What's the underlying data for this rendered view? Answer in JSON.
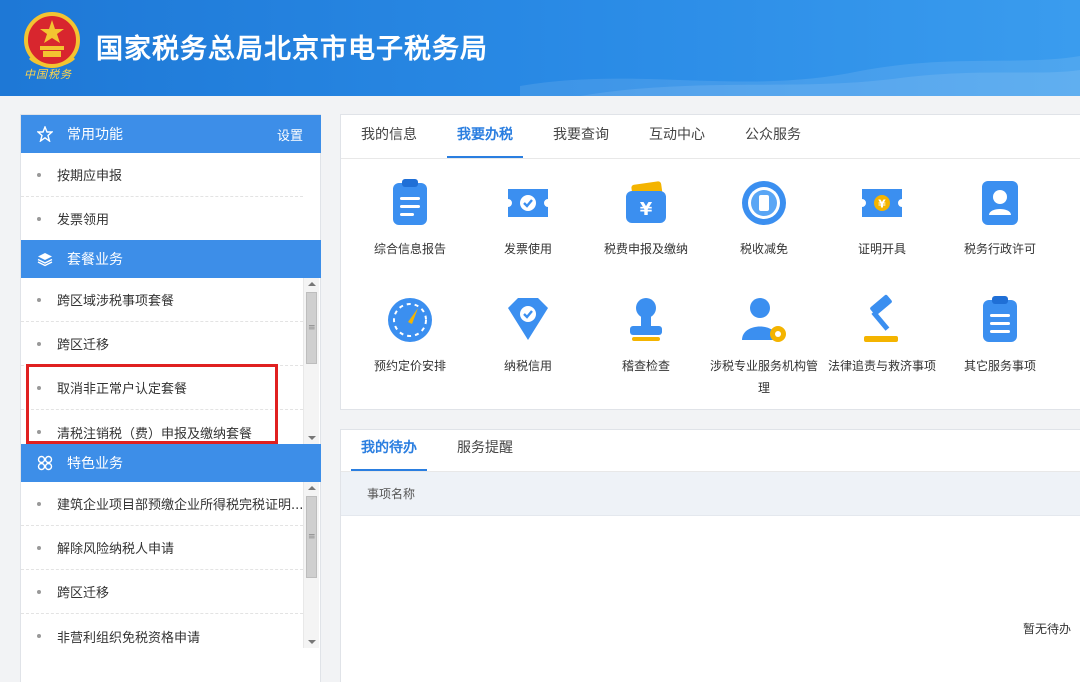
{
  "header": {
    "title": "国家税务总局北京市电子税务局",
    "emblem_caption": "中国税务",
    "colors": {
      "start": "#1e78d6",
      "end": "#3a9cee"
    }
  },
  "sidebar": {
    "common": {
      "title": "常用功能",
      "settings_label": "设置",
      "icon": "star-icon",
      "items": [
        "按期应申报",
        "发票领用"
      ]
    },
    "package": {
      "title": "套餐业务",
      "icon": "layers-icon",
      "items": [
        "跨区域涉税事项套餐",
        "跨区迁移",
        "取消非正常户认定套餐",
        "清税注销税（费）申报及缴纳套餐"
      ]
    },
    "special": {
      "title": "特色业务",
      "icon": "grid-icon",
      "items": [
        "建筑企业项目部预缴企业所得税完税证明...",
        "解除风险纳税人申请",
        "跨区迁移",
        "非营利组织免税资格申请"
      ]
    }
  },
  "main": {
    "tabs": [
      "我的信息",
      "我要办税",
      "我要查询",
      "互动中心",
      "公众服务"
    ],
    "active_tab": "我要办税",
    "services": [
      {
        "label": "综合信息报告",
        "icon": "clipboard-icon"
      },
      {
        "label": "发票使用",
        "icon": "ticket-check-icon"
      },
      {
        "label": "税费申报及缴纳",
        "icon": "wallet-yen-icon"
      },
      {
        "label": "税收减免",
        "icon": "tax-coin-icon"
      },
      {
        "label": "证明开具",
        "icon": "ticket-yen-icon"
      },
      {
        "label": "税务行政许可",
        "icon": "id-card-icon"
      },
      {
        "label": "预约定价安排",
        "icon": "gauge-icon"
      },
      {
        "label": "纳税信用",
        "icon": "diamond-check-icon"
      },
      {
        "label": "稽查检查",
        "icon": "stamp-icon"
      },
      {
        "label": "涉税专业服务机构管理",
        "icon": "user-gear-icon"
      },
      {
        "label": "法律追责与救济事项",
        "icon": "gavel-icon"
      },
      {
        "label": "其它服务事项",
        "icon": "list-doc-icon"
      }
    ]
  },
  "todo": {
    "tabs": [
      "我的待办",
      "服务提醒"
    ],
    "active_tab": "我的待办",
    "column_header": "事项名称",
    "empty_text": "暂无待办"
  },
  "colors": {
    "accent": "#2a7ee0",
    "sidebar_head": "#3d8ee8",
    "highlight_box": "#e02020"
  }
}
